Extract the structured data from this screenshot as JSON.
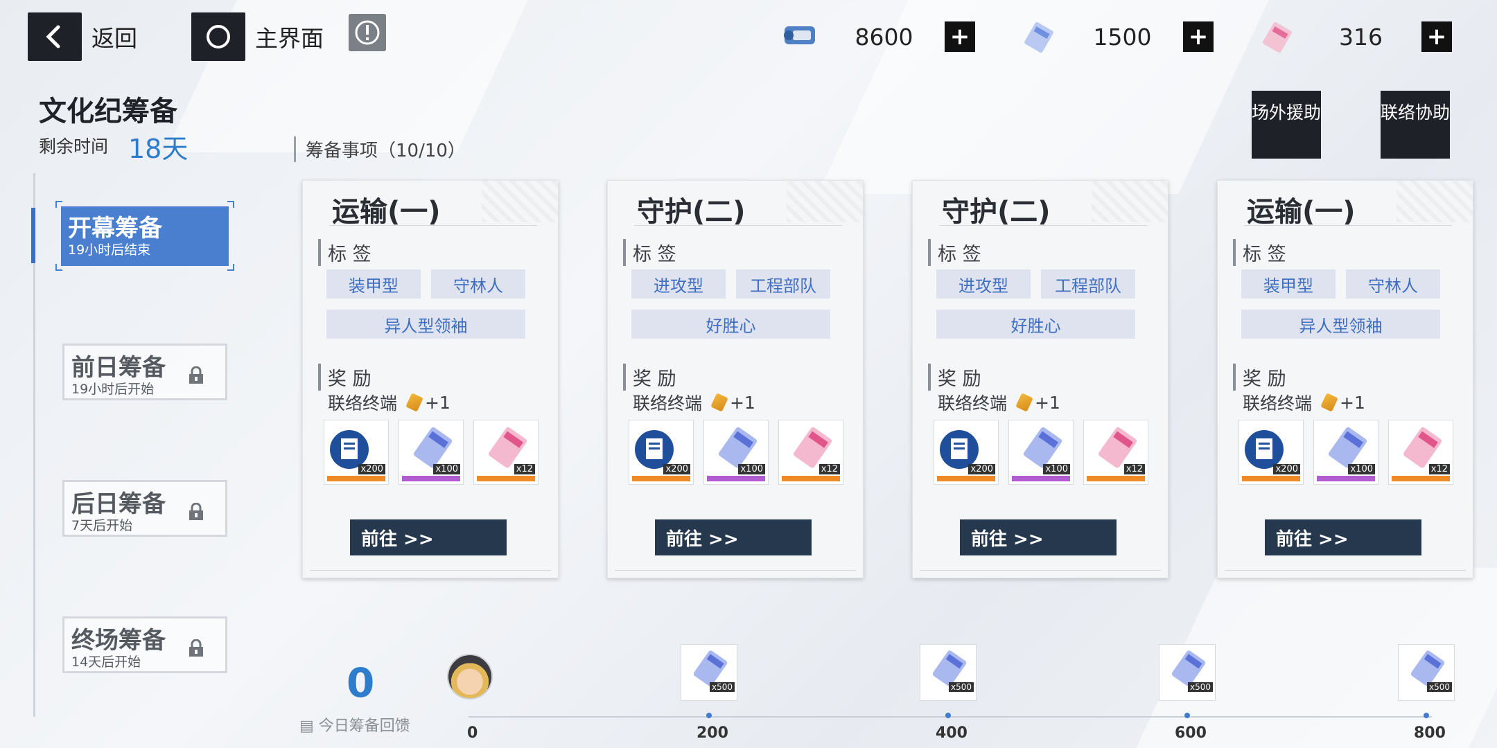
{
  "nav": {
    "back_label": "返回",
    "home_label": "主界面"
  },
  "resources": [
    {
      "icon": "supply-device-icon",
      "value": "8600"
    },
    {
      "icon": "blue-ticket-icon",
      "value": "1500"
    },
    {
      "icon": "pink-ticket-icon",
      "value": "316"
    }
  ],
  "event": {
    "title": "文化纪筹备",
    "remaining_label": "剩余时间",
    "remaining_value": "18天"
  },
  "stages": [
    {
      "title": "开幕筹备",
      "sub": "19小时后结束"
    },
    {
      "title": "前日筹备",
      "sub": "19小时后开始"
    },
    {
      "title": "后日筹备",
      "sub": "7天后开始"
    },
    {
      "title": "终场筹备",
      "sub": "14天后开始"
    }
  ],
  "section": {
    "title": "筹备事项（10/10）"
  },
  "side_buttons": [
    "场外援助",
    "联络协助"
  ],
  "cards": [
    {
      "title": "运输(一)",
      "tags_label": "标 签",
      "tags": [
        "装甲型",
        "守林人",
        "异人型领袖"
      ],
      "reward_label": "奖 励",
      "reward_line": "联络终端",
      "reward_bonus": "+1",
      "items": [
        "x200",
        "x100",
        "x12"
      ],
      "button": "前往 >>"
    },
    {
      "title": "守护(二)",
      "tags_label": "标 签",
      "tags": [
        "进攻型",
        "工程部队",
        "好胜心"
      ],
      "reward_label": "奖 励",
      "reward_line": "联络终端",
      "reward_bonus": "+1",
      "items": [
        "x200",
        "x100",
        "x12"
      ],
      "button": "前往 >>"
    },
    {
      "title": "守护(二)",
      "tags_label": "标 签",
      "tags": [
        "进攻型",
        "工程部队",
        "好胜心"
      ],
      "reward_label": "奖 励",
      "reward_line": "联络终端",
      "reward_bonus": "+1",
      "items": [
        "x200",
        "x100",
        "x12"
      ],
      "button": "前往 >>"
    },
    {
      "title": "运输(一)",
      "tags_label": "标 签",
      "tags": [
        "装甲型",
        "守林人",
        "异人型领袖"
      ],
      "reward_label": "奖 励",
      "reward_line": "联络终端",
      "reward_bonus": "+1",
      "items": [
        "x200",
        "x100",
        "x12"
      ],
      "button": "前往 >>"
    }
  ],
  "feedback": {
    "value": "0",
    "label": "今日筹备回馈",
    "ticks": [
      "0",
      "200",
      "400",
      "600",
      "800"
    ],
    "milestone_count": "x500",
    "progress": 0
  },
  "colors": {
    "accent": "#2e7ccc",
    "active_stage": "#4a7fd0",
    "button_dark": "#26384d"
  }
}
